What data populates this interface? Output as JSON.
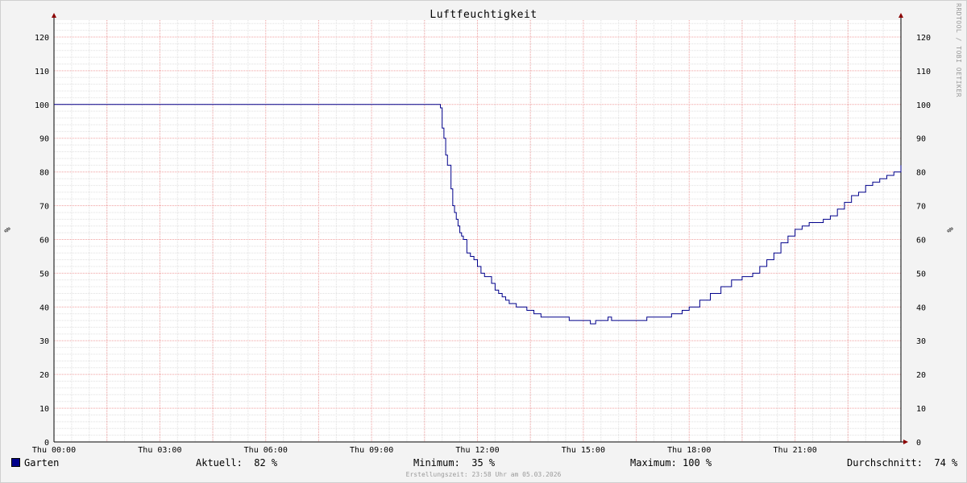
{
  "watermark": "RRDTOOL / TOBI OETIKER",
  "footer_timestamp": "Erstellungszeit: 23:58 Uhr am 05.03.2026",
  "legend": {
    "series_name": "Garten",
    "color": "#00008b",
    "current_label": "Aktuell:",
    "current_value": "82 %",
    "min_label": "Minimum:",
    "min_value": "35 %",
    "max_label": "Maximum:",
    "max_value": "100 %",
    "avg_label": "Durchschnitt:",
    "avg_value": "74 %"
  },
  "chart_data": {
    "type": "line",
    "title": "Luftfeuchtigkeit",
    "ylabel": "%",
    "ylabel_right": "%",
    "ylim": [
      0,
      125
    ],
    "yticks": [
      0,
      10,
      20,
      30,
      40,
      50,
      60,
      70,
      80,
      90,
      100,
      110,
      120
    ],
    "xlim_hours": [
      0,
      24
    ],
    "xticks": [
      {
        "hour": 0,
        "label": "Thu 00:00"
      },
      {
        "hour": 3,
        "label": "Thu 03:00"
      },
      {
        "hour": 6,
        "label": "Thu 06:00"
      },
      {
        "hour": 9,
        "label": "Thu 09:00"
      },
      {
        "hour": 12,
        "label": "Thu 12:00"
      },
      {
        "hour": 15,
        "label": "Thu 15:00"
      },
      {
        "hour": 18,
        "label": "Thu 18:00"
      },
      {
        "hour": 21,
        "label": "Thu 21:00"
      }
    ],
    "grid": true,
    "series": [
      {
        "name": "Garten",
        "color": "#00008b",
        "x_hours": [
          0,
          10.9,
          10.95,
          11.0,
          11.05,
          11.1,
          11.15,
          11.2,
          11.25,
          11.3,
          11.35,
          11.4,
          11.45,
          11.5,
          11.55,
          11.6,
          11.7,
          11.8,
          11.9,
          12.0,
          12.1,
          12.2,
          12.3,
          12.4,
          12.5,
          12.6,
          12.7,
          12.8,
          12.9,
          13.0,
          13.1,
          13.2,
          13.4,
          13.6,
          13.8,
          14.0,
          14.2,
          14.4,
          14.6,
          14.8,
          15.0,
          15.2,
          15.35,
          15.5,
          15.7,
          15.8,
          16.0,
          16.4,
          16.8,
          17.2,
          17.5,
          17.8,
          18.0,
          18.3,
          18.6,
          18.9,
          19.2,
          19.5,
          19.8,
          20.0,
          20.2,
          20.4,
          20.6,
          20.8,
          21.0,
          21.2,
          21.4,
          21.6,
          21.8,
          22.0,
          22.2,
          22.4,
          22.6,
          22.8,
          23.0,
          23.2,
          23.4,
          23.6,
          23.8,
          24.0
        ],
        "values": [
          100,
          100,
          99,
          93,
          90,
          85,
          82,
          82,
          75,
          70,
          68,
          66,
          64,
          62,
          61,
          60,
          56,
          55,
          54,
          52,
          50,
          49,
          49,
          47,
          45,
          44,
          43,
          42,
          41,
          41,
          40,
          40,
          39,
          38,
          37,
          37,
          37,
          37,
          36,
          36,
          36,
          35,
          36,
          36,
          37,
          36,
          36,
          36,
          37,
          37,
          38,
          39,
          40,
          42,
          44,
          46,
          48,
          49,
          50,
          52,
          54,
          56,
          59,
          61,
          63,
          64,
          65,
          65,
          66,
          67,
          69,
          71,
          73,
          74,
          76,
          77,
          78,
          79,
          80,
          82
        ]
      }
    ]
  }
}
